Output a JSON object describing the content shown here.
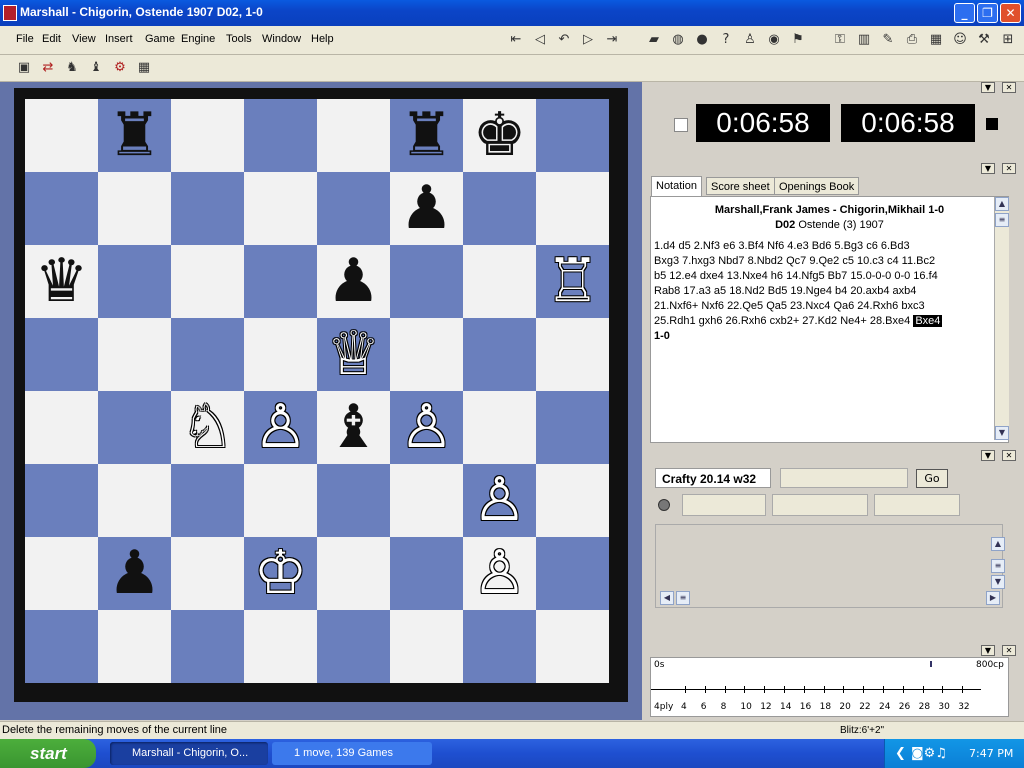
{
  "window": {
    "title": "Marshall - Chigorin, Ostende 1907  D02, 1-0"
  },
  "menu": [
    "File",
    "Edit",
    "View",
    "Insert",
    "Game",
    "Engine",
    "Tools",
    "Window",
    "Help"
  ],
  "toolbar_icons": [
    "first-move-icon",
    "prev-move-icon",
    "undo-icon",
    "next-move-icon",
    "last-move-icon",
    "folder-icon",
    "globe-icon",
    "info-icon",
    "question-icon",
    "engine-icon",
    "ball-icon",
    "flag-icon",
    "key-icon",
    "book-icon",
    "pen-icon",
    "print-icon",
    "board-icon",
    "user-icon",
    "tools-icon",
    "setup-icon"
  ],
  "toolbar2_icons": [
    "save-icon",
    "swap-icon",
    "pieces-icon",
    "pieces2-icon",
    "analysis-icon",
    "grid-icon"
  ],
  "board": {
    "pieces": [
      {
        "sq": "b8",
        "glyph": "♜",
        "color": "b"
      },
      {
        "sq": "f8",
        "glyph": "♜",
        "color": "b"
      },
      {
        "sq": "g8",
        "glyph": "♚",
        "color": "b"
      },
      {
        "sq": "f7",
        "glyph": "♟",
        "color": "b"
      },
      {
        "sq": "a6",
        "glyph": "♛",
        "color": "b"
      },
      {
        "sq": "e6",
        "glyph": "♟",
        "color": "b"
      },
      {
        "sq": "h6",
        "glyph": "♖",
        "color": "w"
      },
      {
        "sq": "e5",
        "glyph": "♕",
        "color": "w"
      },
      {
        "sq": "c4",
        "glyph": "♘",
        "color": "w"
      },
      {
        "sq": "d4",
        "glyph": "♙",
        "color": "w"
      },
      {
        "sq": "e4",
        "glyph": "♝",
        "color": "b"
      },
      {
        "sq": "f4",
        "glyph": "♙",
        "color": "w"
      },
      {
        "sq": "g3",
        "glyph": "♙",
        "color": "w"
      },
      {
        "sq": "b2",
        "glyph": "♟",
        "color": "b"
      },
      {
        "sq": "d2",
        "glyph": "♔",
        "color": "w"
      },
      {
        "sq": "g2",
        "glyph": "♙",
        "color": "w"
      }
    ]
  },
  "clocks": {
    "white": "0:06:58",
    "black": "0:06:58"
  },
  "tabs": [
    "Notation",
    "Score sheet",
    "Openings Book"
  ],
  "notation": {
    "header_line1": "Marshall,Frank James - Chigorin,Mikhail  1-0",
    "header_eco": "D02",
    "header_event": "Ostende (3) 1907",
    "lines": [
      "1.d4  d5  2.Nf3  e6  3.Bf4  Nf6  4.e3  Bd6  5.Bg3  c6  6.Bd3",
      "Bxg3  7.hxg3  Nbd7  8.Nbd2  Qc7  9.Qe2  c5  10.c3  c4  11.Bc2",
      "b5  12.e4  dxe4  13.Nxe4  h6  14.Nfg5  Bb7  15.0-0-0  0-0  16.f4",
      "Rab8  17.a3  a5  18.Nd2  Bd5  19.Nge4  b4  20.axb4  axb4",
      "21.Nxf6+  Nxf6  22.Qe5  Qa5  23.Nxc4  Qa6  24.Rxh6  bxc3",
      "25.Rdh1  gxh6  26.Rxh6  cxb2+  27.Kd2  Ne4+  28.Bxe4"
    ],
    "current_move": "Bxe4",
    "result": "1-0"
  },
  "engine": {
    "name": "Crafty 20.14 w32",
    "go_label": "Go"
  },
  "graph": {
    "left_label": "0s",
    "right_label": "800cp",
    "ply_label": "4ply",
    "ticks": [
      "4",
      "6",
      "8",
      "10",
      "12",
      "14",
      "16",
      "18",
      "20",
      "22",
      "24",
      "26",
      "28",
      "30",
      "32"
    ]
  },
  "status": {
    "message": "Delete the remaining moves of the current line",
    "time_control": "Blitz:6'+2\""
  },
  "taskbar": {
    "start": "start",
    "task1": "Marshall - Chigorin, O...",
    "task2": "1 move,  139 Games",
    "clock": "7:47 PM"
  }
}
